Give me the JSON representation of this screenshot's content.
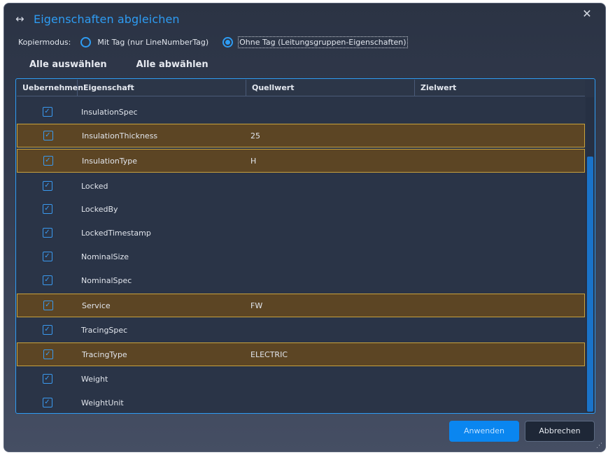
{
  "dialog": {
    "title": "Eigenschaften abgleichen",
    "title_icon": "↔",
    "close_icon": "✕"
  },
  "mode": {
    "label": "Kopiermodus:",
    "options": [
      {
        "label": "Mit Tag (nur LineNumberTag)",
        "checked": false
      },
      {
        "label": "Ohne Tag (Leitungsgruppen-Eigenschaften)",
        "checked": true
      }
    ]
  },
  "selection": {
    "select_all": "Alle auswählen",
    "deselect_all": "Alle abwählen"
  },
  "table": {
    "columns": [
      "Uebernehmen",
      "Eigenschaft",
      "Quellwert",
      "Zielwert"
    ],
    "rows": [
      {
        "checked": true,
        "name": "InsulationSpec",
        "source": "",
        "target": "",
        "highlight": false
      },
      {
        "checked": true,
        "name": "InsulationThickness",
        "source": "25",
        "target": "",
        "highlight": true
      },
      {
        "checked": true,
        "name": "InsulationType",
        "source": "H",
        "target": "",
        "highlight": true
      },
      {
        "checked": true,
        "name": "Locked",
        "source": "",
        "target": "",
        "highlight": false
      },
      {
        "checked": true,
        "name": "LockedBy",
        "source": "",
        "target": "",
        "highlight": false
      },
      {
        "checked": true,
        "name": "LockedTimestamp",
        "source": "",
        "target": "",
        "highlight": false
      },
      {
        "checked": true,
        "name": "NominalSize",
        "source": "",
        "target": "",
        "highlight": false
      },
      {
        "checked": true,
        "name": "NominalSpec",
        "source": "",
        "target": "",
        "highlight": false
      },
      {
        "checked": true,
        "name": "Service",
        "source": "FW",
        "target": "",
        "highlight": true
      },
      {
        "checked": true,
        "name": "TracingSpec",
        "source": "",
        "target": "",
        "highlight": false
      },
      {
        "checked": true,
        "name": "TracingType",
        "source": "ELECTRIC",
        "target": "",
        "highlight": true
      },
      {
        "checked": true,
        "name": "Weight",
        "source": "",
        "target": "",
        "highlight": false
      },
      {
        "checked": true,
        "name": "WeightUnit",
        "source": "",
        "target": "",
        "highlight": false
      }
    ]
  },
  "footer": {
    "apply": "Anwenden",
    "cancel": "Abbrechen"
  },
  "colors": {
    "accent": "#2e9cf3",
    "highlight_bg": "#5c4524",
    "highlight_border": "#c9a23c"
  }
}
